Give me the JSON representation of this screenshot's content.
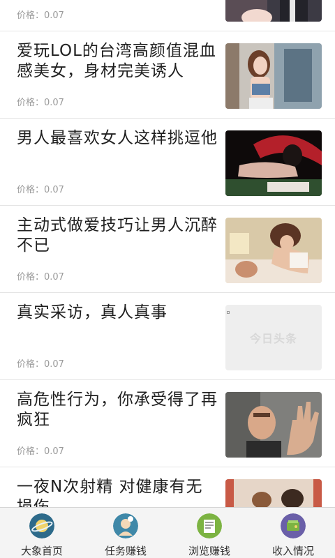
{
  "articles": [
    {
      "title": "",
      "price": "价格：0.07",
      "image": "couple-photo"
    },
    {
      "title": "爱玩LOL的台湾高颜值混血感美女，身材完美诱人",
      "price": "价格：0.07",
      "image": "woman-photo"
    },
    {
      "title": "男人最喜欢女人这样挑逗他",
      "price": "价格：0.07",
      "image": "woman-bed-photo"
    },
    {
      "title": "主动式做爱技巧让男人沉醉不已",
      "price": "价格：0.07",
      "image": "couple-bed-photo"
    },
    {
      "title": "真实采访，真人真事",
      "price": "价格：0.07",
      "image": "placeholder",
      "placeholder_text": "今日头条"
    },
    {
      "title": "高危性行为，你承受得了再疯狂",
      "price": "价格：0.07",
      "image": "man-hand-photo"
    },
    {
      "title": "一夜N次射精 对健康有无损伤",
      "price": "",
      "image": "couple-photo"
    }
  ],
  "tabs": [
    {
      "label": "大象首页",
      "icon": "planet-icon",
      "color": "#2d6a8a"
    },
    {
      "label": "任务赚钱",
      "icon": "task-person-icon",
      "color": "#3f88a8"
    },
    {
      "label": "浏览赚钱",
      "icon": "browse-newspaper-icon",
      "color": "#7cb342"
    },
    {
      "label": "收入情况",
      "icon": "income-wallet-icon",
      "color": "#6a5fa8"
    }
  ]
}
